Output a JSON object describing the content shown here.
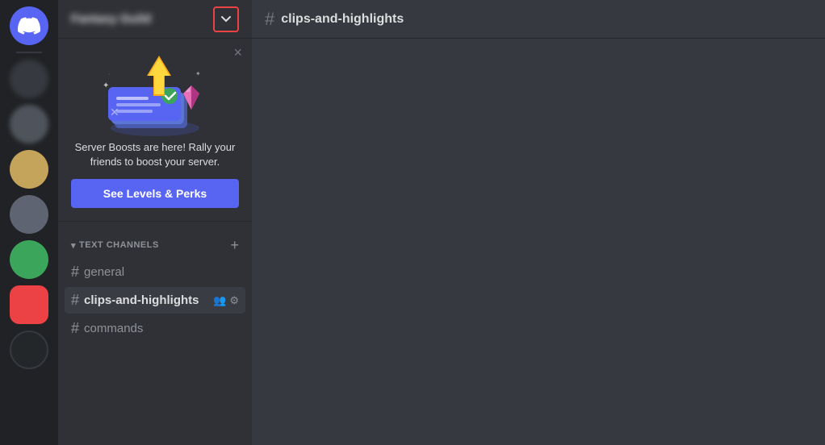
{
  "app": {
    "title": "Discord"
  },
  "server_list": {
    "servers": [
      {
        "id": "discord-home",
        "type": "home"
      },
      {
        "id": "blurred-1",
        "type": "blurred"
      },
      {
        "id": "blurred-2",
        "type": "blurred"
      },
      {
        "id": "avatar-tan",
        "type": "avatar",
        "bg": "#c4a35a"
      },
      {
        "id": "avatar-gray",
        "type": "avatar",
        "bg": "#4f545c"
      },
      {
        "id": "avatar-green",
        "type": "avatar",
        "bg": "#3ba55c"
      },
      {
        "id": "avatar-red",
        "type": "avatar",
        "bg": "#ed4245"
      },
      {
        "id": "avatar-dark",
        "type": "avatar",
        "bg": "#23272a"
      }
    ]
  },
  "channel_sidebar": {
    "server_name": "Fantasy Guild",
    "boost_popup": {
      "message": "Server Boosts are here! Rally your friends to boost your server.",
      "button_label": "See Levels & Perks",
      "close_label": "×"
    },
    "categories": [
      {
        "id": "text-channels",
        "label": "TEXT CHANNELS",
        "channels": [
          {
            "id": "general",
            "name": "general",
            "active": false
          },
          {
            "id": "clips-and-highlights",
            "name": "clips-and-highlights",
            "active": true,
            "show_icons": true
          },
          {
            "id": "commands",
            "name": "commands",
            "active": false
          }
        ]
      }
    ]
  },
  "main": {
    "header": {
      "channel_name": "clips-and-highlights"
    }
  },
  "icons": {
    "chevron_down": "▾",
    "hash": "#",
    "close": "×",
    "add": "+",
    "user_settings": "👤",
    "gear": "⚙"
  }
}
